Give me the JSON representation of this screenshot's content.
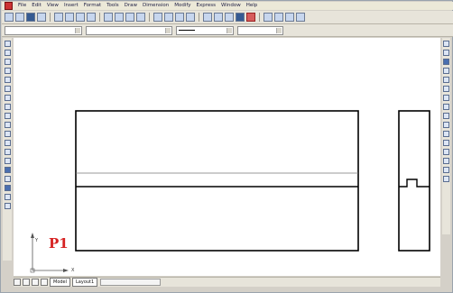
{
  "menubar": {
    "items": [
      "File",
      "Edit",
      "View",
      "Insert",
      "Format",
      "Tools",
      "Draw",
      "Dimension",
      "Modify",
      "Express",
      "Window",
      "Help"
    ]
  },
  "toolbar2": {
    "layer_value": "",
    "style_value": "",
    "lineweight_value": "",
    "color_value": ""
  },
  "drawing": {
    "label": "P1",
    "ucs_x": "X",
    "ucs_y": "Y"
  },
  "tabs": [
    "Model",
    "Layout1"
  ],
  "colors": {
    "label": "#d62222",
    "ui_face": "#e7e4da",
    "canvas": "#ffffff"
  }
}
